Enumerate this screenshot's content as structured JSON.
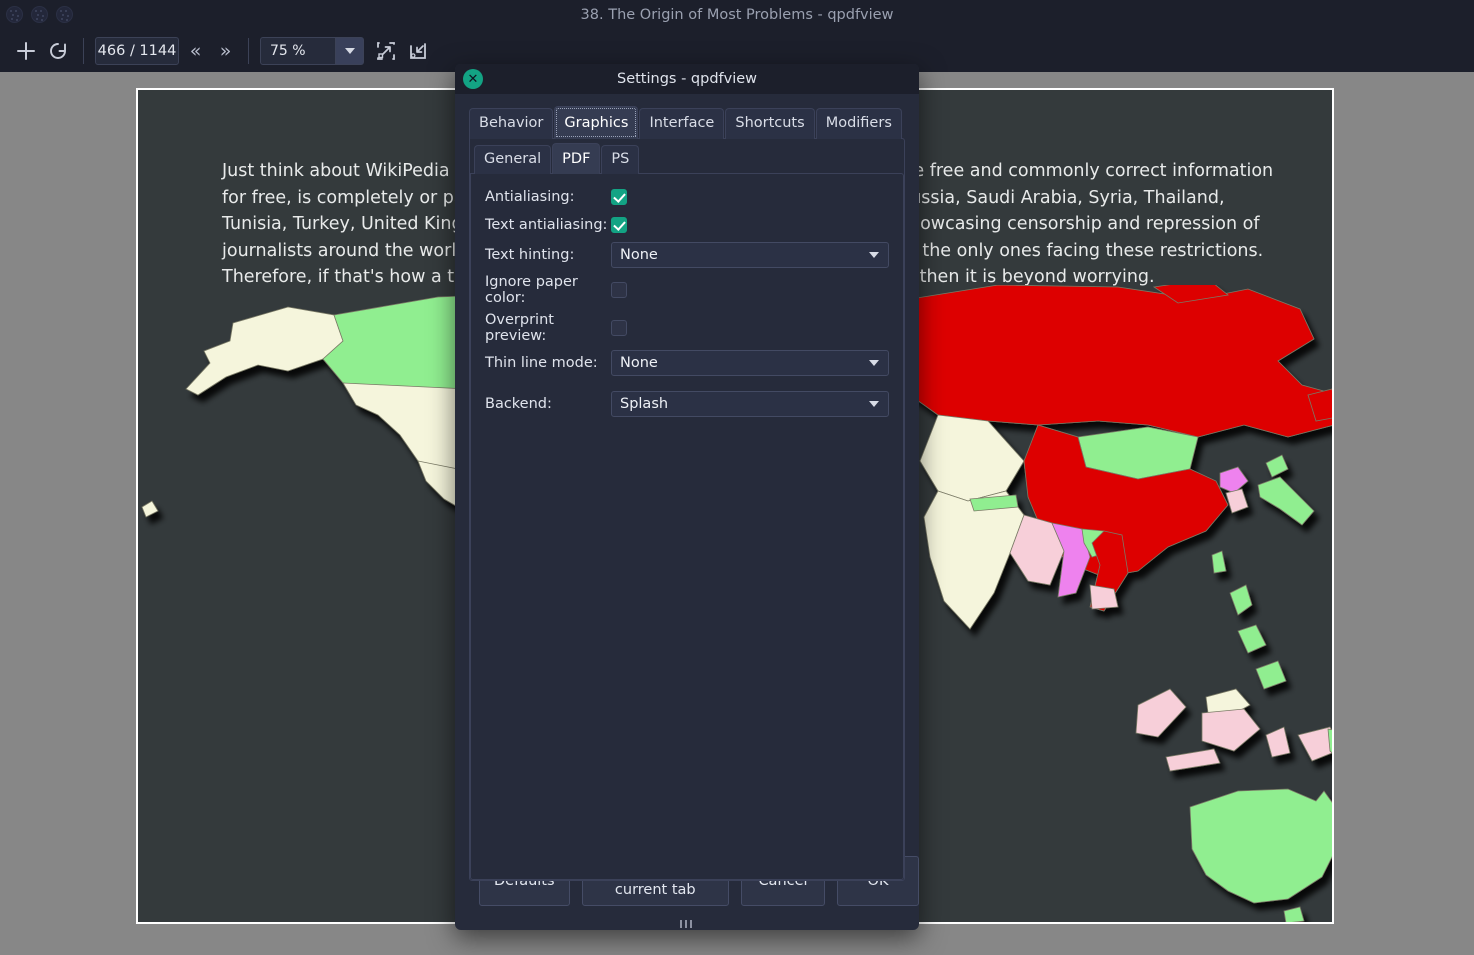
{
  "window": {
    "title": "38. The Origin of Most Problems - qpdfview",
    "controls": [
      "window-dot-1",
      "window-dot-2",
      "window-dot-3"
    ]
  },
  "toolbar": {
    "add_tab_icon": "plus-icon",
    "refresh_icon": "refresh-icon",
    "page_indicator": "466 / 1144",
    "prev_icon": "«",
    "next_icon": "»",
    "zoom_value": "75 %",
    "fit_page_icon": "fit-page-icon",
    "fit_width_icon": "fit-width-icon"
  },
  "document": {
    "body_text": "Just think about WikiPedia which, being a non-profit, open-source website, trade free and commonly correct information for free, is completely or partially blocked in China, Iran, Myanmar, Pakistan, Russia, Saudi Arabia, Syria, Thailand, Tunisia, Turkey, United Kingdom and Uzbekistan. There is an interactive map showcasing censorship and repression of journalists around the world, because ordinary people (regular citizens) are not the only ones facing these restrictions. Therefore, if that's how a tribe who does “little or nothing in excess” looks like, then it is beyond worrying.",
    "body_text_visible_left": "Just think about WikiPedia w\nwebsite, trade free and comn\ncompletely or partially blocke\nPakistan, Russia, Saudi Arabia\nTurkey, United Kingdom and",
    "body_text_visible_right": "interactive map showcasing censorship and\nnalists around the world, because ordinary\nzens) are not the only ones facing these\nore, if that's how a tribe who does “little or\n” looks like, then it is beyond worrying.",
    "map_alt": "world-censorship-map"
  },
  "dialog": {
    "title": "Settings - qpdfview",
    "close_icon": "close-icon",
    "tabs": [
      {
        "label": "Behavior",
        "selected": false
      },
      {
        "label": "Graphics",
        "selected": true
      },
      {
        "label": "Interface",
        "selected": false
      },
      {
        "label": "Shortcuts",
        "selected": false
      },
      {
        "label": "Modifiers",
        "selected": false
      }
    ],
    "subtabs": [
      {
        "label": "General",
        "selected": false
      },
      {
        "label": "PDF",
        "selected": true
      },
      {
        "label": "PS",
        "selected": false
      }
    ],
    "fields": [
      {
        "name": "antialiasing",
        "label": "Antialiasing:",
        "type": "checkbox",
        "checked": true
      },
      {
        "name": "text-antialiasing",
        "label": "Text antialiasing:",
        "type": "checkbox",
        "checked": true
      },
      {
        "name": "text-hinting",
        "label": "Text hinting:",
        "type": "combo",
        "value": "None"
      },
      {
        "name": "ignore-paper-color",
        "label": "Ignore paper color:",
        "type": "checkbox",
        "checked": false
      },
      {
        "name": "overprint-preview",
        "label": "Overprint preview:",
        "type": "checkbox",
        "checked": false
      },
      {
        "name": "thin-line-mode",
        "label": "Thin line mode:",
        "type": "combo",
        "value": "None"
      },
      {
        "name": "backend",
        "label": "Backend:",
        "type": "combo",
        "value": "Splash"
      }
    ],
    "buttons": {
      "defaults": "Defaults",
      "defaults_current_tab": "Defaults on current tab",
      "cancel": "Cancel",
      "ok": "OK"
    }
  },
  "colors": {
    "window_bg": "#1c1f2b",
    "dialog_bg": "#262b3b",
    "accent_teal": "#13a384",
    "doc_viewport": "#878787",
    "page_bg": "#343a3c",
    "map_red": "#dd0000",
    "map_green": "#90ee90",
    "map_cream": "#f5f5dc",
    "map_pink": "#f7cfd9",
    "map_magenta": "#ee82ee"
  }
}
